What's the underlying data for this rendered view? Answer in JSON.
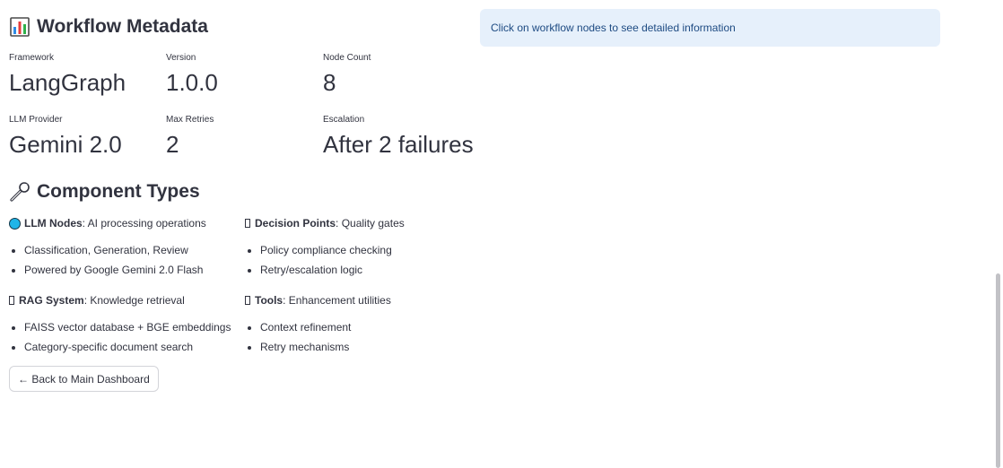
{
  "metadata": {
    "title": "Workflow Metadata",
    "title_icon": "bar-chart-icon",
    "metrics": [
      {
        "label": "Framework",
        "value": "LangGraph"
      },
      {
        "label": "Version",
        "value": "1.0.0"
      },
      {
        "label": "Node Count",
        "value": "8"
      },
      {
        "label": "LLM Provider",
        "value": "Gemini 2.0"
      },
      {
        "label": "Max Retries",
        "value": "2"
      },
      {
        "label": "Escalation",
        "value": "After 2 failures"
      }
    ]
  },
  "info": {
    "message": "Click on workflow nodes to see detailed information"
  },
  "components": {
    "title": "Component Types",
    "title_icon": "wrench-icon",
    "llm": {
      "name": "LLM Nodes",
      "desc": ": AI processing operations",
      "items": [
        "Classification, Generation, Review",
        "Powered by Google Gemini 2.0 Flash"
      ]
    },
    "decision": {
      "name": "Decision Points",
      "desc": ": Quality gates",
      "items": [
        "Policy compliance checking",
        "Retry/escalation logic"
      ]
    },
    "rag": {
      "name": "RAG System",
      "desc": ": Knowledge retrieval",
      "items": [
        "FAISS vector database + BGE embeddings",
        "Category-specific document search"
      ]
    },
    "tools": {
      "name": "Tools",
      "desc": ": Enhancement utilities",
      "items": [
        "Context refinement",
        "Retry mechanisms"
      ]
    }
  },
  "back_button": {
    "label": "← Back to Main Dashboard"
  },
  "colors": {
    "info_bg": "#e6f0fb",
    "info_text": "#1d4a82",
    "llm_dot": "#1fb5e8",
    "text": "#31333f"
  }
}
